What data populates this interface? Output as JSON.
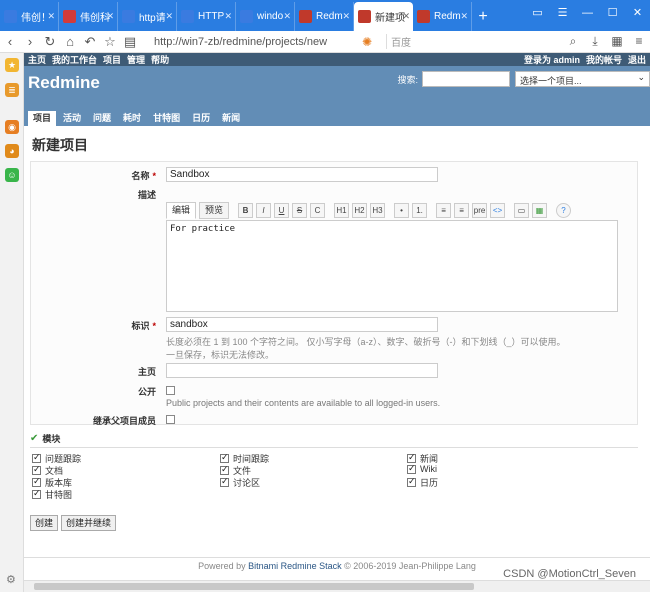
{
  "browser": {
    "tabs": [
      {
        "label": "伟创！",
        "color": "#3a7be0"
      },
      {
        "label": "伟创科",
        "color": "#d23b3b"
      },
      {
        "label": "http请",
        "color": "#3a7be0"
      },
      {
        "label": "HTTP",
        "color": "#3a7be0"
      },
      {
        "label": "windo",
        "color": "#3a7be0"
      },
      {
        "label": "Redm",
        "color": "#c0392b"
      },
      {
        "label": "新建项",
        "color": "#c0392b"
      },
      {
        "label": "Redm",
        "color": "#c0392b"
      }
    ],
    "new_tab": "+",
    "url": "http://win7-zb/redmine/projects/new",
    "search_placeholder": "百度"
  },
  "topmenu": {
    "items": [
      "主页",
      "我的工作台",
      "项目",
      "管理",
      "帮助"
    ],
    "logged_in": "登录为 admin",
    "my_account": "我的帐号",
    "logout": "退出"
  },
  "header": {
    "title": "Redmine",
    "search_label": "搜索:",
    "project_jump": "选择一个项目..."
  },
  "mainmenu": [
    "项目",
    "活动",
    "问题",
    "耗时",
    "甘特图",
    "日历",
    "新闻"
  ],
  "page_title": "新建项目",
  "form": {
    "name_label": "名称",
    "name_value": "Sandbox",
    "desc_label": "描述",
    "tab_edit": "编辑",
    "tab_preview": "预览",
    "toolbar": [
      "B",
      "I",
      "U",
      "S",
      "C",
      "H1",
      "H2",
      "H3",
      "•",
      "1.",
      "≡",
      "≡",
      "pre",
      "<>",
      "▭",
      "▦",
      "?"
    ],
    "desc_value": "For practice",
    "identifier_label": "标识",
    "identifier_value": "sandbox",
    "identifier_hint1": "长度必须在 1 到 100 个字符之间。 仅小写字母（a-z）、数字、破折号（-）和下划线（_）可以使用。",
    "identifier_hint2": "一旦保存，标识无法修改。",
    "homepage_label": "主页",
    "public_label": "公开",
    "public_hint": "Public projects and their contents are available to all logged-in users.",
    "inherit_label": "继承父项目成员"
  },
  "modules": {
    "legend": "模块",
    "items": [
      "问题跟踪",
      "文档",
      "版本库",
      "甘特图",
      "时间跟踪",
      "文件",
      "讨论区",
      "新闻",
      "Wiki",
      "日历"
    ]
  },
  "actions": {
    "create": "创建",
    "create_continue": "创建并继续"
  },
  "footer": {
    "prefix": "Powered by ",
    "link": "Bitnami Redmine Stack",
    "suffix": " © 2006-2019 Jean-Philippe Lang"
  },
  "watermark": "CSDN @MotionCtrl_Seven"
}
